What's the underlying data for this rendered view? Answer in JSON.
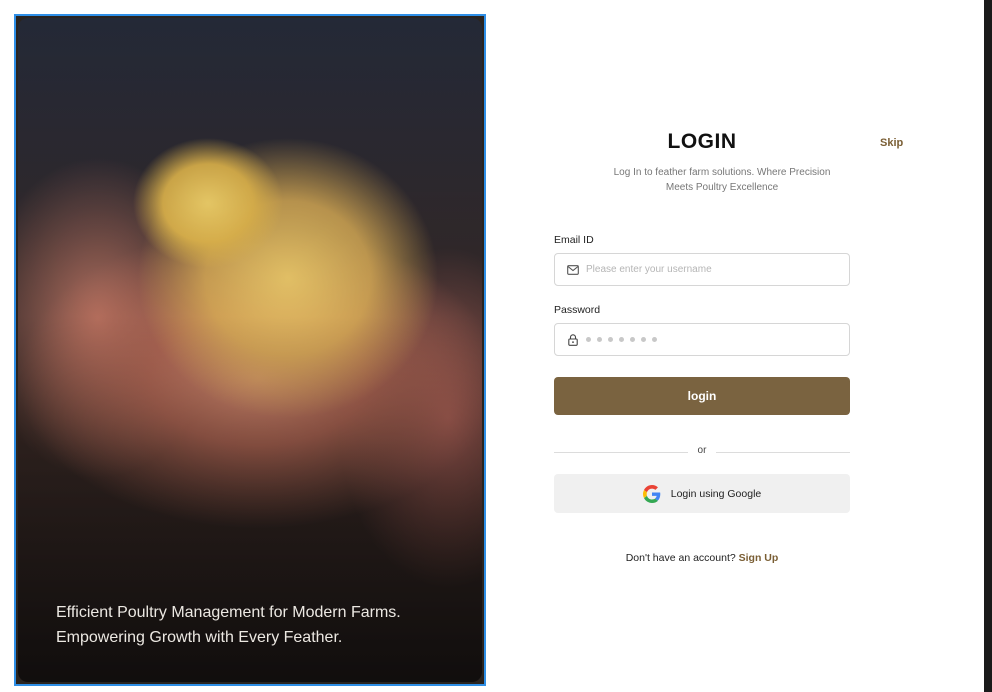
{
  "hero": {
    "caption_line1": "Efficient Poultry Management for Modern Farms.",
    "caption_line2": "Empowering Growth with Every Feather."
  },
  "login": {
    "title": "LOGIN",
    "skip_label": "Skip",
    "subtitle": "Log In to feather farm solutions. Where Precision Meets Poultry Excellence",
    "email_label": "Email ID",
    "email_placeholder": "Please enter your username",
    "email_icon": "mail-icon",
    "password_label": "Password",
    "password_icon": "lock-icon",
    "login_button": "login",
    "or_text": "or",
    "google_button": "Login using Google",
    "google_icon": "google-icon",
    "signup_prompt": "Don't have an account?",
    "signup_link": "Sign Up"
  },
  "colors": {
    "accent": "#7a6340",
    "link": "#7a5e34",
    "selection_border": "#2f8fe6"
  }
}
